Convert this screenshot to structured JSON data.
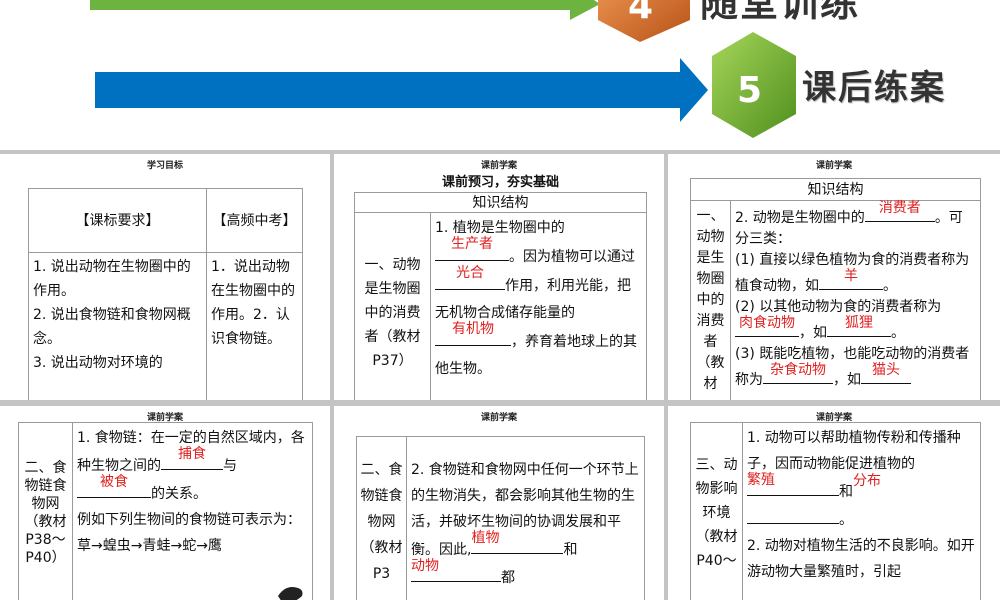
{
  "header": {
    "item4": {
      "number": "4",
      "label": "随堂训练"
    },
    "item5": {
      "number": "5",
      "label": "课后练案"
    }
  },
  "panels": {
    "p1": {
      "title": "学习目标",
      "col1_header": "【课标要求】",
      "col2_header": "【高频中考】",
      "col1_items": [
        "1. 说出动物在生物圈中的作用。",
        "2. 说出食物链和食物网概念。",
        "3. 说出动物对环境的"
      ],
      "col2_text": "1．说出动物在生物圈中的作用。2．认识食物链。"
    },
    "p2": {
      "title": "课前学案",
      "subtitle": "课前预习，夯实基础",
      "table_header": "知识结构",
      "left": "一、动物是生物圈中的消费者（教材P37）",
      "t1": "1. 植物是生物圈中的",
      "a1": "生产者",
      "t2": "。因为植物可以通过",
      "a2": "光合",
      "t3": "作用，利用光能，把无机物合成储存能量的",
      "a3": "有机物",
      "t4": "，养育着地球上的其他生物。"
    },
    "p3": {
      "title": "课前学案",
      "table_header": "知识结构",
      "left": "一、动物是生物圈中的消费者（教材",
      "t1": "2. 动物是生物圈中的",
      "a1": "消费者",
      "t2": "。可分三类：",
      "t3": "(1) 直接以绿色植物为食的消费者称为植食动物，如",
      "a_mid": "羊",
      "t4": "。",
      "t5": "(2) 以其他动物为食的消费者称为",
      "a2": "肉食动物",
      "t6": "，如",
      "a3": "狐狸",
      "t7": "。",
      "t8": "(3) 既能吃植物，也能吃动物的消费者称为",
      "a4": "杂食动物",
      "t9": "，如",
      "a5": "猫头"
    },
    "p4": {
      "title": "课前学案",
      "left": "二、食物链食物网（教材P38～P40）",
      "t1": "1. 食物链：在一定的自然区域内，各种生物之间的",
      "a1": "捕食",
      "t2": "与",
      "a2": "被食",
      "t3": "的关系。",
      "t4": "例如下列生物间的食物链可表示为：草→蝗虫→青蛙→蛇→鹰"
    },
    "p5": {
      "title": "课前学案",
      "left": "二、食物链食物网（教材P3",
      "t1": "2. 食物链和食物网中任何一个环节上的生物消失，都会影响其他生物的生活，并破坏生物间的协调发展和平衡。因此,",
      "a1": "植物",
      "t2": "和",
      "a2": "动物",
      "t3": "都"
    },
    "p6": {
      "title": "课前学案",
      "left": "三、动物影响环境（教材P40～",
      "t1": "1. 动物可以帮助植物传粉和传播种子，因而动物能促进植物的",
      "a1": "繁殖",
      "t2": "和",
      "a2": "分布",
      "t3": "。",
      "t4": "2. 动物对植物生活的不良影响。如开游动物大量繁殖时，引起"
    }
  },
  "colors": {
    "blue_arrow": "#0070c0",
    "green_arrow": "#76b531",
    "orange_badge": "#d96b2a",
    "answer_red": "#e02020"
  }
}
